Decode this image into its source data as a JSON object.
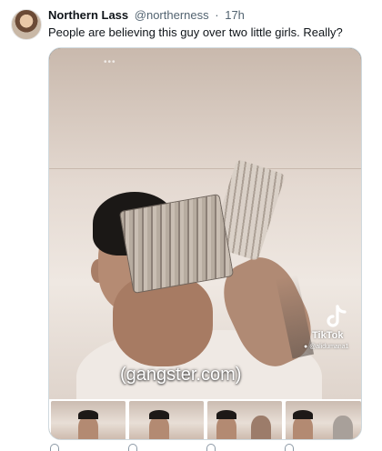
{
  "tweet": {
    "author_name": "Northern Lass",
    "author_handle": "@northerness",
    "separator": "·",
    "timestamp": "17h",
    "text": "People are believing this guy over two little girls. Really?"
  },
  "media": {
    "watermark_brand": "TikTok",
    "watermark_user": "@alidumana1",
    "caption": "(gangster.com)",
    "top_indicator": "•••"
  },
  "icons": {
    "tiktok": "tiktok-logo-icon",
    "user": "user-icon"
  }
}
